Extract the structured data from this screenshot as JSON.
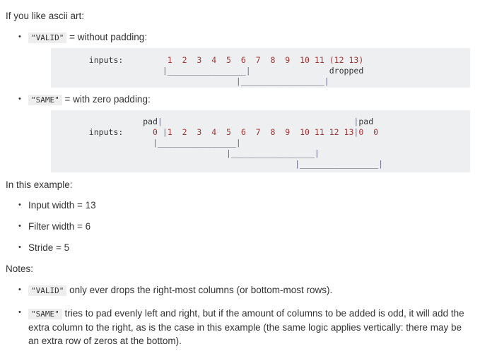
{
  "intro": {
    "text": "If you like ascii art:"
  },
  "modes": [
    {
      "code": "\"VALID\"",
      "description": " = without padding:",
      "ascii": "    inputs:         1  2  3  4  5  6  7  8  9  10 11 (12 13)\n                   |________________|                dropped\n                                  |_________________|"
    },
    {
      "code": "\"SAME\"",
      "description": " = with zero padding:",
      "ascii": "               pad|                                       |pad\n    inputs:      0 |1  2  3  4  5  6  7  8  9  10 11 12 13|0  0\n                 |________________|\n                                |_________________|\n                                              |________________|"
    }
  ],
  "example": {
    "heading": "In this example:",
    "items": [
      "Input width = 13",
      "Filter width = 6",
      "Stride = 5"
    ]
  },
  "notes": {
    "heading": "Notes:",
    "items": [
      {
        "code": "\"VALID\"",
        "text": " only ever drops the right-most columns (or bottom-most rows)."
      },
      {
        "code": "\"SAME\"",
        "text": " tries to pad evenly left and right, but if the amount of columns to be added is odd, it will add the extra column to the right, as is the case in this example (the same logic applies vertically: there may be an extra row of zeros at the bottom)."
      }
    ]
  },
  "colors": {
    "code_block_background": "#eeeff1",
    "inline_code_background": "#eeeeee",
    "text": "#333333",
    "number_token": "#a03636",
    "page_background": "#ffffff"
  }
}
